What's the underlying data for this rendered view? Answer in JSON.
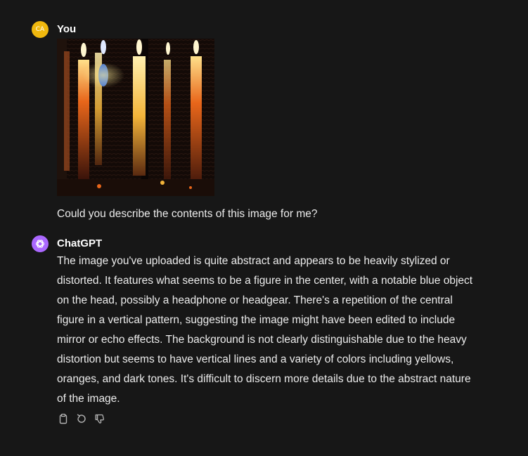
{
  "conversation": {
    "user": {
      "avatar_initials": "CA",
      "author": "You",
      "image": {
        "description": "stylized abstract image with vertical candles",
        "colors": {
          "background": "#120b08",
          "flame": "#fff6d0",
          "candle_orange": "#e8661a",
          "candle_yellow": "#f3b43a",
          "blue_object": "#4a7bd6"
        }
      },
      "text": "Could you describe the contents of this image for me?"
    },
    "assistant": {
      "author": "ChatGPT",
      "lines": [
        "The image you've uploaded is quite abstract and appears to be heavily stylized or",
        "distorted. It features what seems to be a figure in the center, with a notable blue object",
        "on the head, possibly a headphone or headgear. There's a repetition of the central",
        "figure in a vertical pattern, suggesting the image might have been edited to include",
        "mirror or echo effects. The background is not clearly distinguishable due to the heavy",
        "distortion but seems to have vertical lines and a variety of colors including yellows,",
        "oranges, and dark tones. It's difficult to discern more details due to the abstract nature",
        "of the image."
      ],
      "actions": [
        {
          "icon": "clipboard-icon"
        },
        {
          "icon": "regenerate-icon"
        },
        {
          "icon": "thumbs-down-icon"
        }
      ]
    }
  },
  "colors": {
    "page_bg": "#171717",
    "text": "#ececec",
    "user_avatar": "#f0b80e",
    "assistant_avatar": "#ab68ff",
    "icon": "#b4b4b4"
  }
}
